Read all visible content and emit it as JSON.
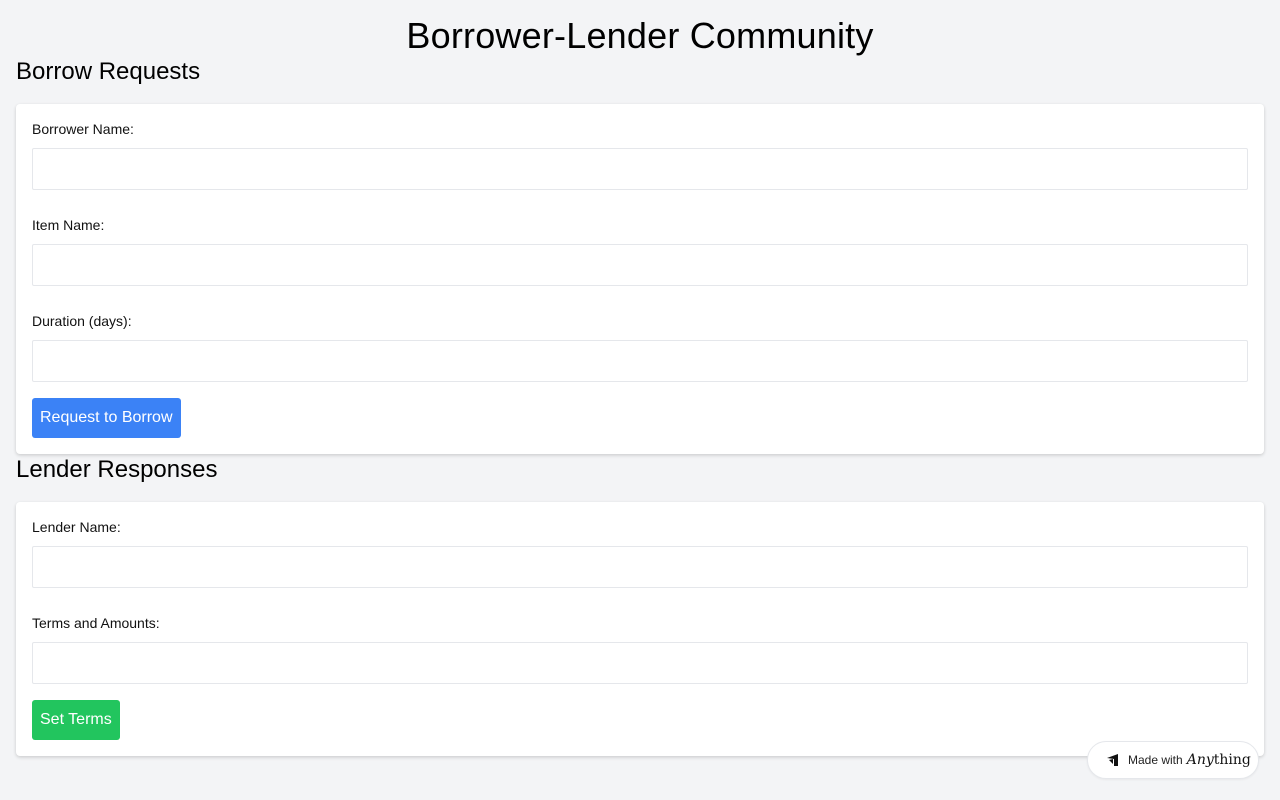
{
  "page": {
    "title": "Borrower-Lender Community"
  },
  "borrow_section": {
    "title": "Borrow Requests",
    "fields": [
      {
        "label": "Borrower Name:",
        "value": ""
      },
      {
        "label": "Item Name:",
        "value": ""
      },
      {
        "label": "Duration (days):",
        "value": ""
      }
    ],
    "button_label": "Request to Borrow",
    "button_color": "#3b82f6"
  },
  "lender_section": {
    "title": "Lender Responses",
    "fields": [
      {
        "label": "Lender Name:",
        "value": ""
      },
      {
        "label": "Terms and Amounts:",
        "value": ""
      }
    ],
    "button_label": "Set Terms",
    "button_color": "#22c55e"
  },
  "badge": {
    "text": "Made with",
    "brand_italic": "Any",
    "brand_rest": "thing",
    "icon": "anything-logo-icon"
  }
}
